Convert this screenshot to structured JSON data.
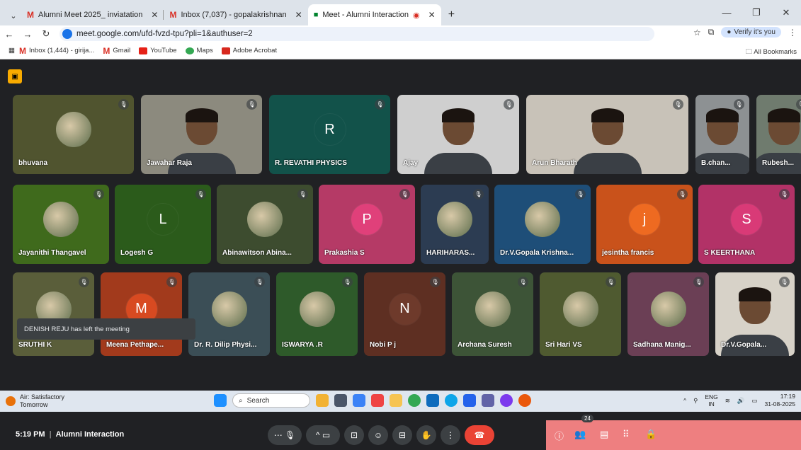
{
  "browser": {
    "tabs": [
      {
        "title": "Alumni Meet 2025_ inviatation"
      },
      {
        "title": "Inbox (7,037) - gopalakrishnan"
      },
      {
        "title": "Meet - Alumni Interaction"
      }
    ],
    "url": "meet.google.com/ufd-fvzd-tpu?pli=1&authuser=2",
    "verify_label": "Verify it's you",
    "bookmarks": [
      "Inbox (1,444) - girija...",
      "Gmail",
      "YouTube",
      "Maps",
      "Adobe Acrobat"
    ],
    "all_bookmarks": "All Bookmarks"
  },
  "meeting": {
    "participants_row1": [
      {
        "name": "bhuvana",
        "bg": "#50542f",
        "type": "photo"
      },
      {
        "name": "Jawahar Raja",
        "bg": "#8c8a7e",
        "type": "cam"
      },
      {
        "name": "R. REVATHI PHYSICS",
        "bg": "#12524a",
        "type": "letter",
        "letter": "R",
        "avbg": "#12524a"
      },
      {
        "name": "Ajay",
        "bg": "#cfcfcf",
        "type": "cam"
      },
      {
        "name": "Arun Bharath",
        "bg": "#c8c2b8",
        "type": "cam"
      },
      {
        "name": "B.chan...",
        "bg": "#8d9193",
        "type": "cam"
      },
      {
        "name": "Rubesh...",
        "bg": "#6f7b6e",
        "type": "cam"
      }
    ],
    "participants_row2": [
      {
        "name": "Jayanithi Thangavel",
        "bg": "#3f6a1c",
        "type": "photo"
      },
      {
        "name": "Logesh G",
        "bg": "#2b5b1b",
        "type": "letter",
        "letter": "L",
        "avbg": "#2b5b1b"
      },
      {
        "name": "Abinawitson Abina...",
        "bg": "#3d4c2f",
        "type": "photo"
      },
      {
        "name": "Prakashia S",
        "bg": "#b53a66",
        "type": "letter",
        "letter": "P",
        "avbg": "#e0407a"
      },
      {
        "name": "HARIHARAS...",
        "bg": "#2c3c52",
        "type": "photo"
      },
      {
        "name": "Dr.V.Gopala Krishna...",
        "bg": "#1e4e78",
        "type": "photo"
      },
      {
        "name": "jesintha francis",
        "bg": "#c9521b",
        "type": "letter",
        "letter": "j",
        "avbg": "#ee6a21"
      },
      {
        "name": "S KEERTHANA",
        "bg": "#b23267",
        "type": "letter",
        "letter": "S",
        "avbg": "#d93a77"
      }
    ],
    "participants_row3": [
      {
        "name": "SRUTHI K",
        "bg": "#5a5e3a",
        "type": "photo"
      },
      {
        "name": "Meena Pethape...",
        "bg": "#a23a1c",
        "type": "letter",
        "letter": "M",
        "avbg": "#d84a21"
      },
      {
        "name": "Dr. R. Dilip Physi...",
        "bg": "#3b4e56",
        "type": "photo"
      },
      {
        "name": "ISWARYA .R",
        "bg": "#2e5a2a",
        "type": "photo"
      },
      {
        "name": "Nobi P j",
        "bg": "#5e2f22",
        "type": "letter",
        "letter": "N",
        "avbg": "#6e3a2b"
      },
      {
        "name": "Archana Suresh",
        "bg": "#3d5437",
        "type": "photo"
      },
      {
        "name": "Sri Hari VS",
        "bg": "#4f5a30",
        "type": "photo"
      },
      {
        "name": "Sadhana Manig...",
        "bg": "#6b3f55",
        "type": "photo"
      },
      {
        "name": "Dr.V.Gopala...",
        "bg": "#d7d2c8",
        "type": "cam"
      }
    ],
    "toast": "DENISH REJU has left the meeting",
    "time": "5:19 PM",
    "meeting_name": "Alumni Interaction",
    "participant_count": "24"
  },
  "taskbar": {
    "weather_title": "Air: Satisfactory",
    "weather_sub": "Tomorrow",
    "search_label": "Search",
    "lang": "ENG",
    "region": "IN",
    "time": "17:19",
    "date": "31-08-2025"
  }
}
